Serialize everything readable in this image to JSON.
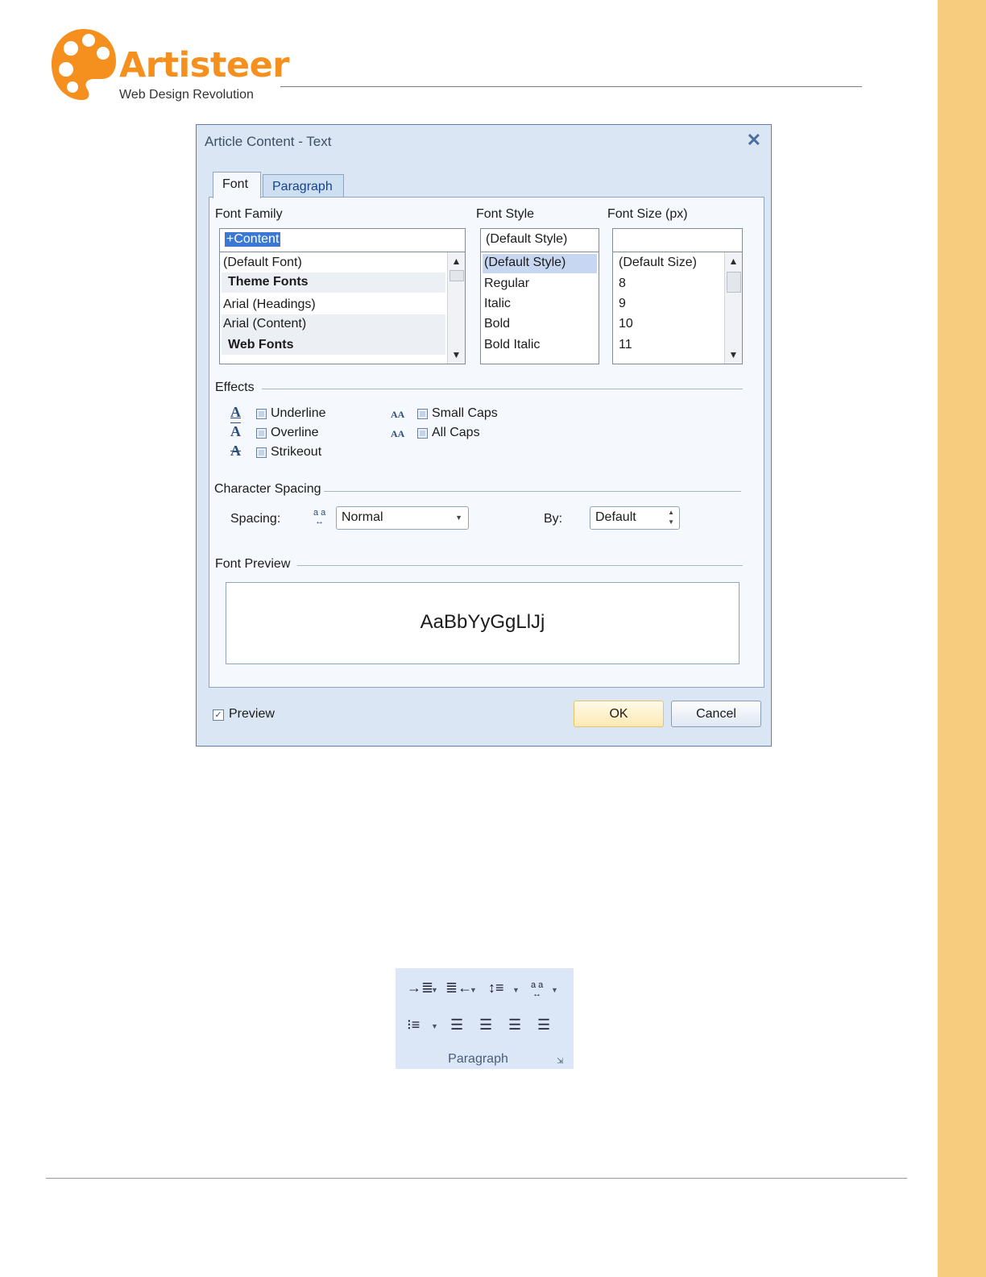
{
  "brand": {
    "name": "Artisteer",
    "tagline": "Web Design Revolution",
    "accent_color": "#f5901e",
    "sidebar_color": "#f7cc7e",
    "logo_icon": "palette-icon"
  },
  "dialog": {
    "title": "Article Content - Text",
    "close_icon": "close-icon",
    "tabs": [
      {
        "label": "Font",
        "active": true
      },
      {
        "label": "Paragraph",
        "active": false
      }
    ],
    "font_family": {
      "label": "Font Family",
      "value": "+Content",
      "items": [
        {
          "text": "(Default Font)"
        },
        {
          "text": "Theme Fonts",
          "group": true
        },
        {
          "text": "Arial (Headings)"
        },
        {
          "text": "Arial (Content)",
          "selected": true
        },
        {
          "text": "Web Fonts",
          "group": true
        }
      ]
    },
    "font_style": {
      "label": "Font Style",
      "value": "(Default Style)",
      "items": [
        "(Default Style)",
        "Regular",
        "Italic",
        "Bold",
        "Bold Italic"
      ]
    },
    "font_size": {
      "label": "Font Size (px)",
      "value": "",
      "items": [
        "(Default Size)",
        "8",
        "9",
        "10",
        "11"
      ]
    },
    "effects": {
      "label": "Effects",
      "underline": "Underline",
      "overline": "Overline",
      "strikeout": "Strikeout",
      "small_caps": "Small Caps",
      "all_caps": "All Caps",
      "icon_small_caps": "AA",
      "icon_all_caps": "AA"
    },
    "character_spacing": {
      "label": "Character Spacing",
      "spacing_label": "Spacing:",
      "spacing_value": "Normal",
      "by_label": "By:",
      "by_value": "Default"
    },
    "font_preview": {
      "label": "Font Preview",
      "sample": "AaBbYyGgLlJj"
    },
    "preview_checkbox": {
      "label": "Preview",
      "checked": true
    },
    "ok_label": "OK",
    "cancel_label": "Cancel"
  },
  "ribbon": {
    "group_label": "Paragraph"
  }
}
